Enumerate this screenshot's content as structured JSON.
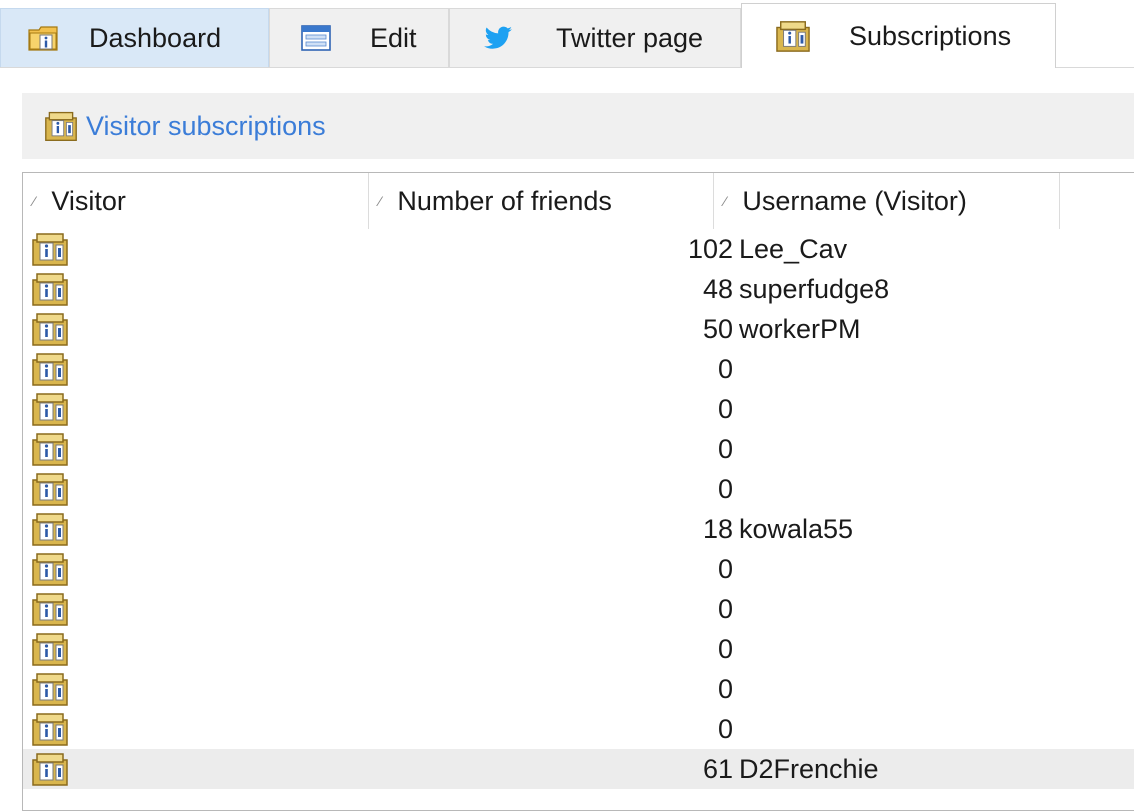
{
  "tabs": [
    {
      "label": "Dashboard",
      "icon": "info-folder-icon"
    },
    {
      "label": "Edit",
      "icon": "form-window-icon"
    },
    {
      "label": "Twitter page",
      "icon": "twitter-bird-icon"
    },
    {
      "label": "Subscriptions",
      "icon": "info-box-icon",
      "active": true
    }
  ],
  "panel": {
    "title": "Visitor subscriptions",
    "icon": "info-box-icon"
  },
  "grid": {
    "columns": [
      "Visitor",
      "Number of friends",
      "Username (Visitor)"
    ],
    "rows": [
      {
        "friends": "102",
        "username": "Lee_Cav"
      },
      {
        "friends": "48",
        "username": "superfudge8"
      },
      {
        "friends": "50",
        "username": "workerPM"
      },
      {
        "friends": "0",
        "username": ""
      },
      {
        "friends": "0",
        "username": ""
      },
      {
        "friends": "0",
        "username": ""
      },
      {
        "friends": "0",
        "username": ""
      },
      {
        "friends": "18",
        "username": "kowala55"
      },
      {
        "friends": "0",
        "username": ""
      },
      {
        "friends": "0",
        "username": ""
      },
      {
        "friends": "0",
        "username": ""
      },
      {
        "friends": "0",
        "username": ""
      },
      {
        "friends": "0",
        "username": ""
      },
      {
        "friends": "61",
        "username": "D2Frenchie",
        "selected": true
      }
    ]
  },
  "colors": {
    "accent_link": "#3b7dd8",
    "twitter_blue": "#1da1f2",
    "selected_row": "#ececec"
  }
}
